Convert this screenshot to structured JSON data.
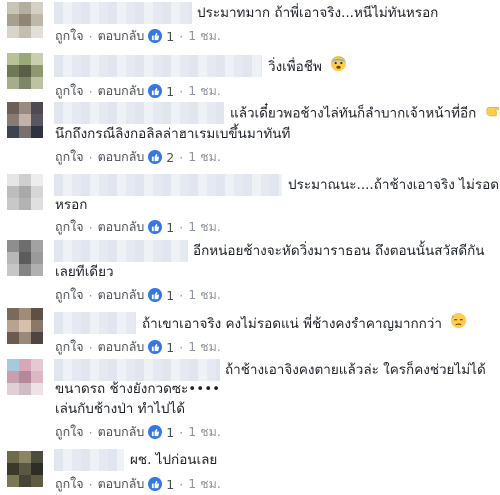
{
  "labels": {
    "like": "ถูกใจ",
    "reply": "ตอบกลับ",
    "dot": "·"
  },
  "comments": [
    {
      "lines": [
        "ประมาทมาก ถ้าพี่เอาจริง...หนีไม่ทันหรอก"
      ],
      "likes": "1",
      "time": "1 ชม."
    },
    {
      "lines": [
        "วิ่งเพื่อชีพ"
      ],
      "likes": "1",
      "time": "1 ชม.",
      "emoji": "fearful-face-icon"
    },
    {
      "lines": [
        "แล้วเดี๋ยวพอช้างไล่ทันก็ลำบากเจ้าหน้าที่อีก",
        "นึกถึงกรณีลิงกอลิลล่าฮาเรมเบขึ้นมาทันที"
      ],
      "likes": "2",
      "time": "1 ชม.",
      "emoji": "pointing-hand-icon"
    },
    {
      "lines": [
        "ประมาณนะ....ถ้าช้างเอาจริง ไม่รอด",
        "หรอก"
      ],
      "likes": "1",
      "time": "1 ชม."
    },
    {
      "lines": [
        "อีกหน่อยช้างจะหัดวิ่งมาราธอน ถึงตอนนั้นสวัสดีกัน",
        "เลยทีเดียว"
      ],
      "likes": "1",
      "time": "1 ชม."
    },
    {
      "lines": [
        "ถ้าเขาเอาจริง คงไม่รอดแน่ พี่ช้างคงรำคาญมากกว่า"
      ],
      "likes": "1",
      "time": "1 ชม.",
      "emoji": "sweat-face-icon"
    },
    {
      "lines": [
        "ถ้าช้างเอาจิงคงตายแล้วล่ะ ใครก็คงช่วยไม่ได้",
        "ขนาดรถ ช้างยังกวดซะ••••",
        "เล่นกับช้างป่า ทำไปได้"
      ],
      "likes": "1",
      "time": "1 ชม."
    },
    {
      "lines": [
        "ผช. ไปก่อนเลย"
      ],
      "likes": "1",
      "time": "1 ชม."
    }
  ],
  "colors": {
    "link": "#4b4f56",
    "likeBlue": "#3578e5",
    "text": "#1d2129"
  }
}
